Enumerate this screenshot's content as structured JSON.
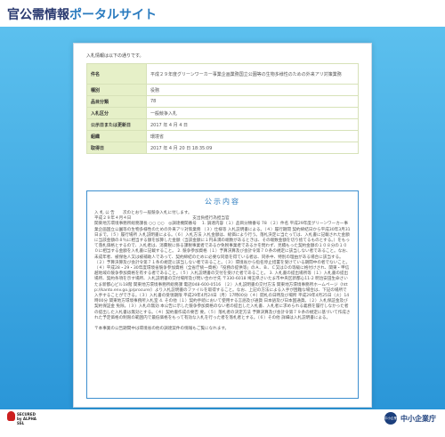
{
  "header": {
    "site_title": "官公需情報",
    "site_subtitle": "ポータルサイト"
  },
  "intro": "入札情報は以下の通りです。",
  "info_table": {
    "rows": [
      {
        "key": "件名",
        "value": "平成２９年度グリーンワーカー事業企画業務国立公園等の生物多様性のための外来アリ対策業務"
      },
      {
        "key": "種別",
        "value": "役務"
      },
      {
        "key": "品目分類",
        "value": "78"
      },
      {
        "key": "入札区分",
        "value": "一般競争入札"
      },
      {
        "key": "公示日または更新日",
        "value": "2017 年 4 月 4 日"
      },
      {
        "key": "組織",
        "value": "環境省"
      },
      {
        "key": "取得日",
        "value": "2017 年 4 月 20 日 18:35:09"
      }
    ]
  },
  "notice": {
    "title": "公示内容",
    "body": "入 札 公 告　　次のとおり一般競争入札に付します。\n平成２９年４月４日　　　　　　　　　　　　　　　支出負担行為担当官\n関東地方環境事務所総務課長 ○○ ○○　◎調達機関番号　 1. 調達内容（１）品目分類番号 78 （２）件名 平成29年度グリーンワーカー事業企画国立公園等の生物多様性のための外来アリ対策業務 （３）仕様等 入札説明書による。（４）履行期間 契約締結日から平成30年3月31日まで。（５）履行場所 入札説明書による。（６）入札方法 入札金額は、総価により行う。落札決定に当たっては、入札書に記載された金額に当該金額の８％に相当する額を加算した金額（当該金額に１円未満の端数があるときは、その端数金額を切り捨てるものとする。）をもって落札価格とするので、入札者は、消費税に係る課税事業者であるか免税事業者であるかを問わず、見積もった契約金額の１０８分の１００に相当する金額を入札書に記載すること。 2. 競争参加資格（１）予算決算及び会計令第７０条の規定に該当しない者であること。なお、未成年者、被保佐人又は被補助人であって、契約締結のために必要な同意を得ている者は、同条中、特別の理由がある場合に該当する。（２）予算決算及び会計令第７１条の規定に該当しない者であること。（３）環境省から指名停止措置を受けている期間中の者でないこと。（４）平成28・29・30年度環境省競争参加資格（全省庁統一資格）「役務の提供等」のＡ、Ｂ、Ｃ又はＤの等級に格付けされ、関東・甲信越地域の競争参加資格を有する者であること。（５）入札説明書の交付を受けた者であること。 3. 入札書の提出場所等（１）入札書の提出場所、契約条項を示す場所、入札説明書の交付場所及び問い合わせ先 〒330-6018 埼玉県さいたま市中央区新都心11-2 明治安田生命さいたま新都心ビル18階 関東地方環境事務所総務課 電話048-600-0516 （２）入札説明書の交付方法 関東地方環境事務所ホームページ（http://kanto.env.go.jp/procure/）より入札説明書のファイルを取得すること。なお、上記の方法による入手が困難な場合は、下記の場所で入手することができる。（３）入札書の受領期限 平成29年4月24日（月）17時00分（４）開札の日時及び場所 平成29年4月25日（火）14時00分 関東地方環境事務所入札室 4. その他（１）契約手続において使用する言語及び通貨 日本語及び日本国通貨。（２）入札保証金及び契約保証金 免除。（３）入札の無効 本公告に示した競争参加資格のない者の提出した入札書、入札者に求められる義務を履行しなかった者の提出した入札書は無効とする。（４）契約書作成の要否 要。（５）落札者の決定方法 予算決算及び会計令第７９条の規定に基づいて作成された予定価格の制限の範囲内で最低価格をもって有効な入札を行った者を落札者とする。（６）その他 詳細は入札説明書による。\n\n〒本事業の公告期間中は環境省の他の調達案件の情報もご覧になれます。"
  },
  "footer": {
    "secure_line1": "SECURED",
    "secure_line2": "by ALPHA SSL",
    "agency_mark": "中小企業庁",
    "agency_name": "中小企業庁"
  },
  "colors": {
    "bg_top": "#5cc0ee",
    "bg_bottom": "#2a96d8",
    "title": "#2a3a70",
    "accent": "#2a7bbf",
    "table_key_bg": "#e6f0c8"
  }
}
